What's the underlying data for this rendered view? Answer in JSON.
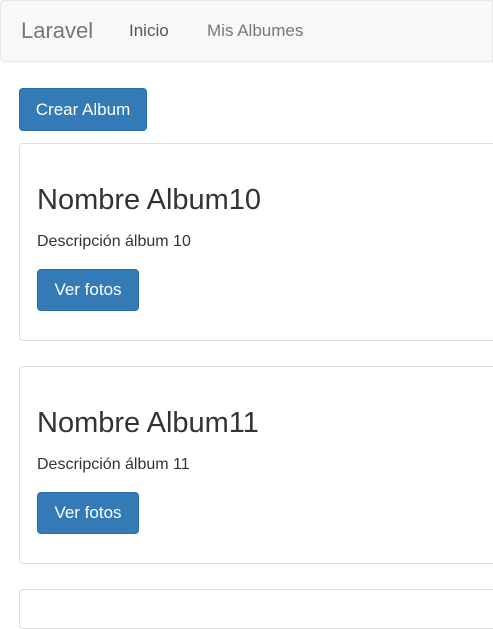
{
  "navbar": {
    "brand": "Laravel",
    "links": [
      {
        "label": "Inicio"
      },
      {
        "label": "Mis Albumes"
      }
    ]
  },
  "actions": {
    "create_album_label": "Crear Album"
  },
  "albums": [
    {
      "title": "Nombre Album10",
      "description": "Descripción álbum 10",
      "button_label": "Ver fotos"
    },
    {
      "title": "Nombre Album11",
      "description": "Descripción álbum 11",
      "button_label": "Ver fotos"
    }
  ],
  "colors": {
    "primary": "#337ab7",
    "navbar_bg": "#f8f8f8",
    "border": "#dddddd"
  }
}
